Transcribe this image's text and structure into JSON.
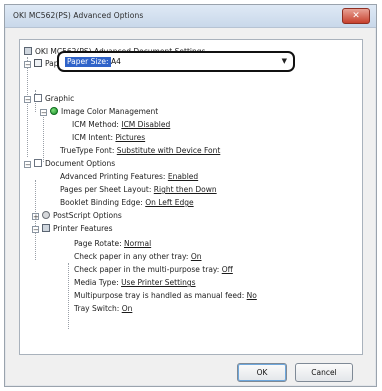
{
  "window": {
    "title": "OKI MC562(PS) Advanced Options",
    "close_label": "✕"
  },
  "tree": {
    "root": "OKI MC562(PS) Advanced Document Settings",
    "paper_output": "Paper/Output",
    "paper_size": {
      "label": "Paper Size:",
      "value": "A4"
    },
    "graphic": "Graphic",
    "icm": "Image Color Management",
    "icm_method": {
      "label": "ICM Method:",
      "value": "ICM Disabled"
    },
    "icm_intent": {
      "label": "ICM Intent:",
      "value": "Pictures"
    },
    "truetype": {
      "label": "TrueType Font:",
      "value": "Substitute with Device Font"
    },
    "doc_options": "Document Options",
    "adv_printing": {
      "label": "Advanced Printing Features:",
      "value": "Enabled"
    },
    "pages_per_sheet": {
      "label": "Pages per Sheet Layout:",
      "value": "Right then Down"
    },
    "booklet": {
      "label": "Booklet Binding Edge:",
      "value": "On Left Edge"
    },
    "postscript": "PostScript Options",
    "printer_features": "Printer Features",
    "page_rotate": {
      "label": "Page Rotate:",
      "value": "Normal"
    },
    "check_other_tray": {
      "label": "Check paper in any other tray:",
      "value": "On"
    },
    "check_mp_tray": {
      "label": "Check paper in the multi-purpose tray:",
      "value": "Off"
    },
    "media_type": {
      "label": "Media Type:",
      "value": "Use Printer Settings"
    },
    "mp_manual": {
      "label": "Multipurpose tray is handled as manual feed:",
      "value": "No"
    },
    "tray_switch": {
      "label": "Tray Switch:",
      "value": "On"
    }
  },
  "buttons": {
    "ok": "OK",
    "cancel": "Cancel"
  }
}
